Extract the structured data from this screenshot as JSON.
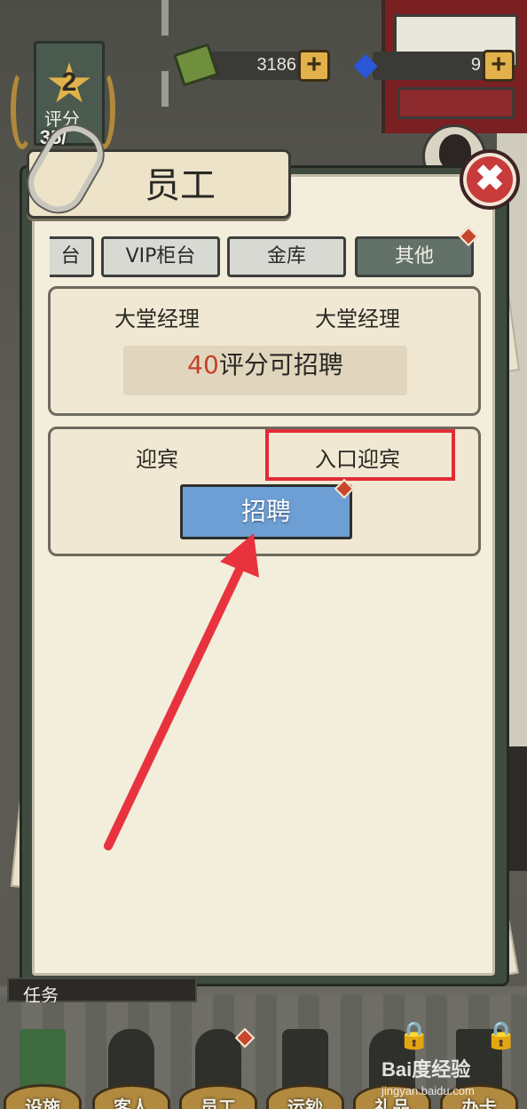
{
  "hud": {
    "rating_level": "2",
    "rating_label": "评分",
    "rating_progress": "35/",
    "cash": "3186",
    "gems": "9",
    "plus": "+"
  },
  "dialog": {
    "title": "员工",
    "close": "✖",
    "tabs": [
      {
        "label": "台"
      },
      {
        "label": "VIP柜台"
      },
      {
        "label": "金库"
      },
      {
        "label": "其他",
        "selected": true
      }
    ],
    "cards": [
      {
        "left_name": "大堂经理",
        "right_name": "大堂经理",
        "requirement_number": "40",
        "requirement_text": "评分可招聘"
      },
      {
        "left_name": "迎宾",
        "right_name": "入口迎宾",
        "hire_label": "招聘"
      }
    ]
  },
  "bottom": {
    "task_label": "任务",
    "nav": [
      {
        "label": "设施"
      },
      {
        "label": "客人"
      },
      {
        "label": "员工"
      },
      {
        "label": "运钞"
      },
      {
        "label": "礼品"
      },
      {
        "label": "办卡"
      }
    ]
  },
  "watermark": {
    "main": "Bai度经验",
    "sub": "jingyan.baidu.com"
  },
  "colors": {
    "accent_red": "#e02b36",
    "hire_blue": "#6e9fd4",
    "selected_tab": "#627169",
    "requirement_number": "#c3412b"
  },
  "icons": [
    "star-icon",
    "cash-icon",
    "gem-icon",
    "plus-icon",
    "paperclip-icon",
    "close-icon",
    "lock-icon",
    "red-arrow-icon"
  ]
}
